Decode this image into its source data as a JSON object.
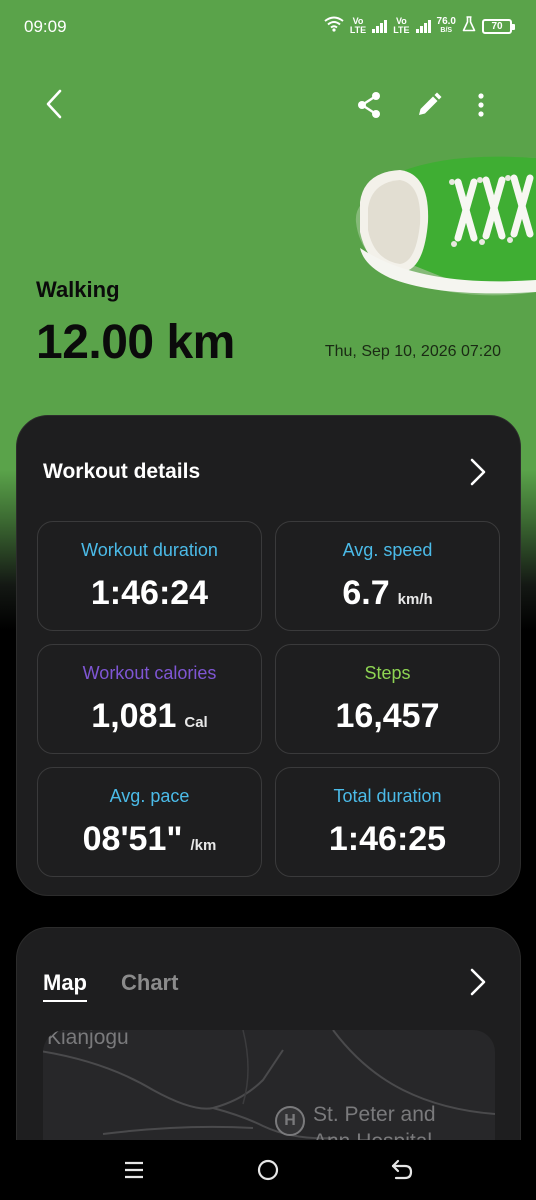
{
  "status_bar": {
    "time": "09:09",
    "sim1": "Vo",
    "sim1_sub": "LTE",
    "sim2": "Vo",
    "sim2_sub": "LTE",
    "speed": "76.0",
    "speed_unit": "B/S",
    "battery": "70"
  },
  "header": {
    "icons": [
      "back-icon",
      "share-icon",
      "edit-icon",
      "more-vert-icon"
    ],
    "illustration": "green-sneaker"
  },
  "summary": {
    "activity": "Walking",
    "distance": "12.00 km",
    "datetime": "Thu, Sep 10, 2026 07:20"
  },
  "workout_details": {
    "title": "Workout details",
    "stats": [
      {
        "label": "Workout duration",
        "value": "1:46:24",
        "unit": "",
        "color": "#4bbbe8"
      },
      {
        "label": "Avg. speed",
        "value": "6.7",
        "unit": "km/h",
        "color": "#4bbbe8"
      },
      {
        "label": "Workout calories",
        "value": "1,081",
        "unit": "Cal",
        "color": "#7f56d4"
      },
      {
        "label": "Steps",
        "value": "16,457",
        "unit": "",
        "color": "#8ed453"
      },
      {
        "label": "Avg. pace",
        "value": "08'51\"",
        "unit": "/km",
        "color": "#4bbbe8"
      },
      {
        "label": "Total duration",
        "value": "1:46:25",
        "unit": "",
        "color": "#4bbbe8"
      }
    ]
  },
  "map_card": {
    "tabs": [
      "Map",
      "Chart"
    ],
    "active_tab": "Map",
    "map_labels": [
      "Kianjogu",
      "St. Peter and",
      "Ann Hospital"
    ],
    "map_pin": "H"
  },
  "nav": {
    "icons": [
      "recents-icon",
      "home-icon",
      "back-nav-icon"
    ]
  },
  "colors": {
    "header_green": "#5aa34a",
    "card_bg": "#1e1e1f",
    "accent_blue": "#4bbbe8",
    "accent_purple": "#7f56d4",
    "accent_green": "#8ed453"
  }
}
